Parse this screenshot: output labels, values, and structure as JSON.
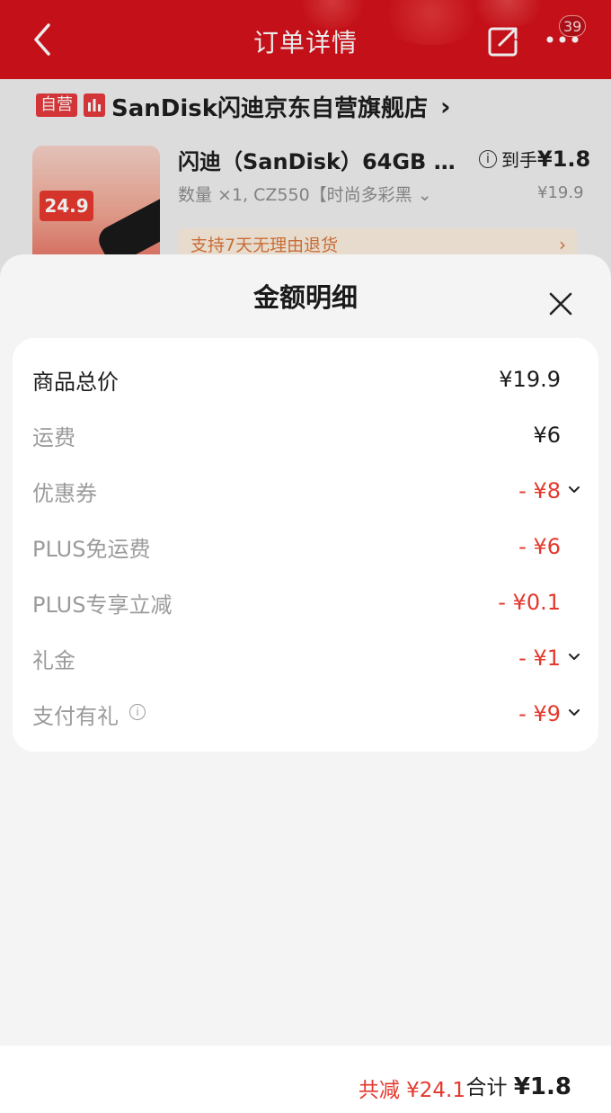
{
  "header": {
    "title": "订单详情",
    "badge_count": "39"
  },
  "store": {
    "tag": "自营",
    "name": "SanDisk闪迪京东自营旗舰店",
    "arrow": "›"
  },
  "product": {
    "title": "闪迪（SanDisk）64GB …",
    "spec": "数量 ×1, CZ550【时尚多彩黑 ⌄",
    "final_label": "到手",
    "final_price": "¥1.8",
    "original_price": "¥19.9",
    "thumb_price": "24.9",
    "return_policy": "支持7天无理由退货"
  },
  "sheet": {
    "title": "金额明细",
    "rows": [
      {
        "label": "商品总价",
        "value": "¥19.9"
      },
      {
        "label": "运费",
        "value": "¥6"
      },
      {
        "label": "优惠券",
        "value": "- ¥8"
      },
      {
        "label": "PLUS免运费",
        "value": "- ¥6"
      },
      {
        "label": "PLUS专享立减",
        "value": "- ¥0.1"
      },
      {
        "label": "礼金",
        "value": "- ¥1"
      },
      {
        "label": "支付有礼",
        "value": "- ¥9"
      }
    ]
  },
  "footer": {
    "reduction_label": "共减 ¥24.1",
    "total_label": "合计",
    "total_value": "¥1.8"
  },
  "colors": {
    "header_red": "#d5131c",
    "discount_red": "#e4382d",
    "return_orange": "#d9773a"
  },
  "icons": [
    "back-icon",
    "share-icon",
    "more-icon",
    "store-icon",
    "info-icon",
    "close-icon",
    "chevron-down-icon"
  ]
}
